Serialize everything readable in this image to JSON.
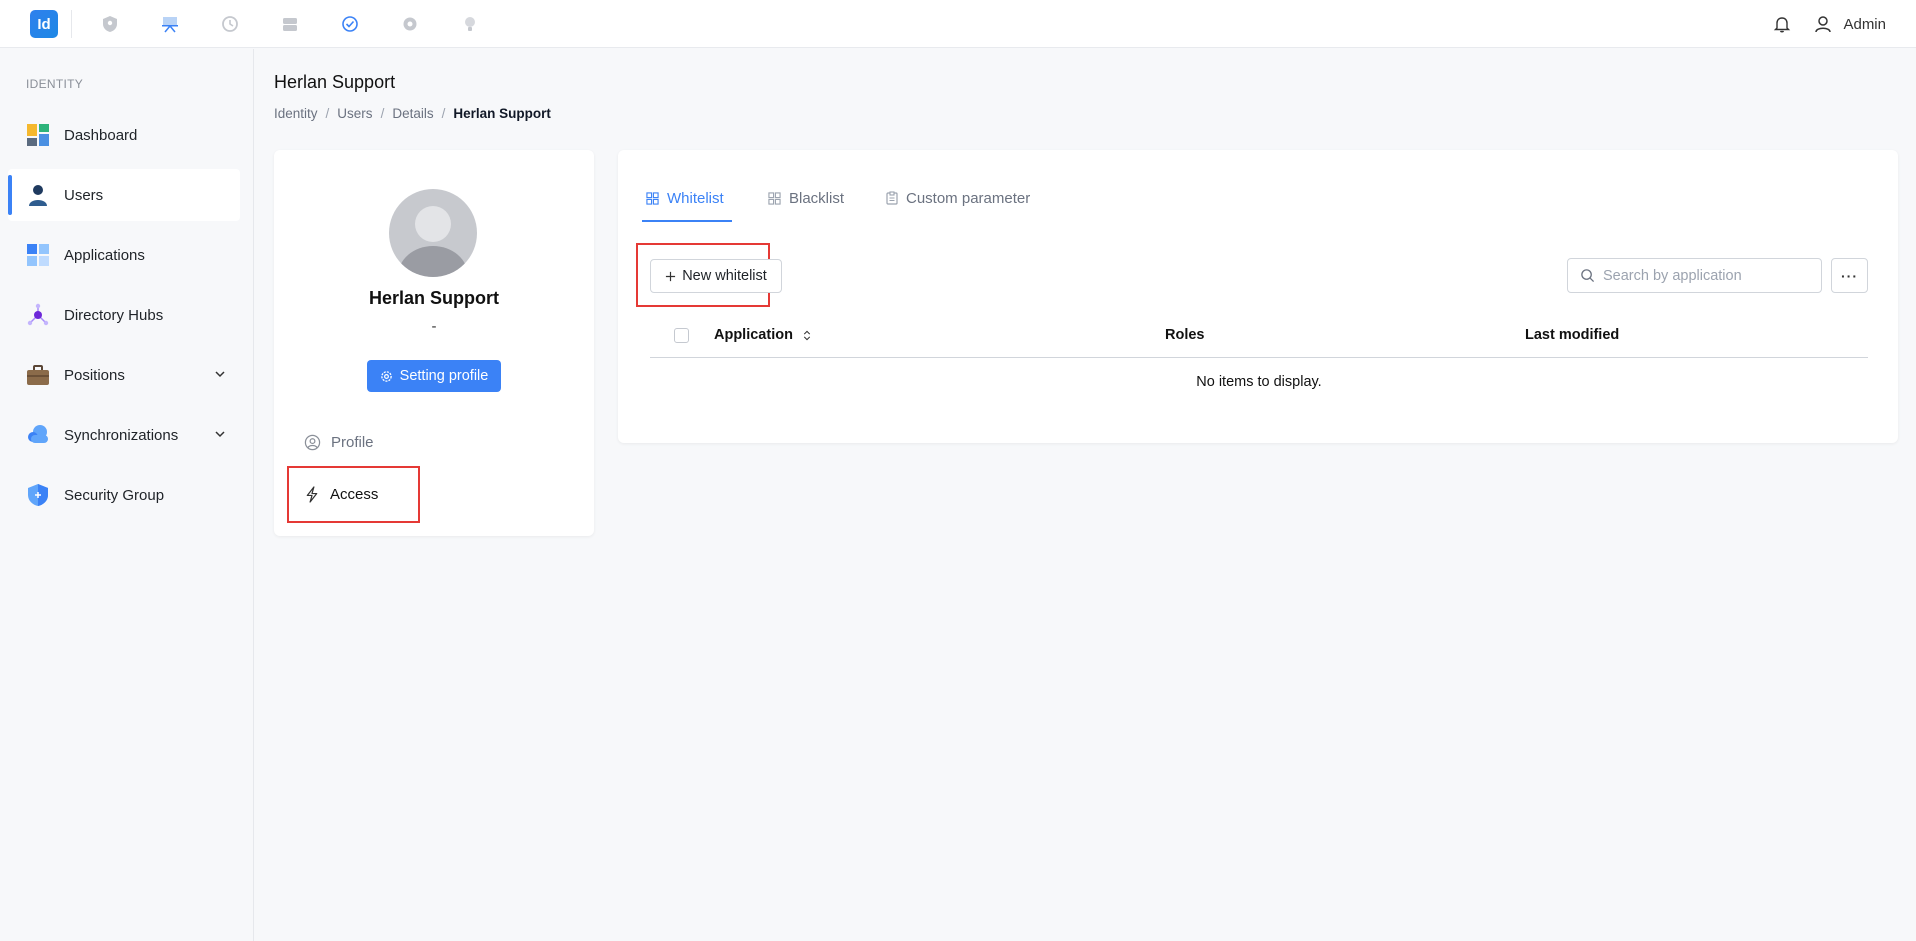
{
  "topbar": {
    "logo_text": "Id",
    "apps": [
      {
        "name": "shield-app-icon"
      },
      {
        "name": "presentation-app-icon"
      },
      {
        "name": "clock-app-icon"
      },
      {
        "name": "drive-app-icon"
      },
      {
        "name": "check-circle-app-icon"
      },
      {
        "name": "gear-app-icon"
      },
      {
        "name": "lightbulb-app-icon"
      }
    ],
    "user_label": "Admin",
    "accent": "#3b82f6"
  },
  "sidebar": {
    "section_label": "IDENTITY",
    "items": [
      {
        "label": "Dashboard",
        "icon": "dashboard-icon"
      },
      {
        "label": "Users",
        "icon": "user-icon",
        "active": true
      },
      {
        "label": "Applications",
        "icon": "applications-icon"
      },
      {
        "label": "Directory Hubs",
        "icon": "hub-icon"
      },
      {
        "label": "Positions",
        "icon": "briefcase-icon",
        "expandable": true
      },
      {
        "label": "Synchronizations",
        "icon": "cloud-sync-icon",
        "expandable": true
      },
      {
        "label": "Security Group",
        "icon": "shield-icon"
      }
    ]
  },
  "header": {
    "title": "Herlan Support",
    "breadcrumb": [
      "Identity",
      "Users",
      "Details",
      "Herlan Support"
    ]
  },
  "profile": {
    "name": "Herlan Support",
    "subtitle": "-",
    "setting_button": "Setting profile",
    "menu": [
      {
        "label": "Profile",
        "icon": "user-circle-icon"
      },
      {
        "label": "Access",
        "icon": "lightning-icon"
      }
    ]
  },
  "main": {
    "tabs": [
      {
        "label": "Whitelist",
        "icon": "grid-icon",
        "active": true
      },
      {
        "label": "Blacklist",
        "icon": "grid-icon"
      },
      {
        "label": "Custom parameter",
        "icon": "clipboard-icon"
      }
    ],
    "new_button": "New whitelist",
    "search_placeholder": "Search by application",
    "more_label": "···",
    "columns": [
      "Application",
      "Roles",
      "Last modified"
    ],
    "empty_text": "No items to display."
  }
}
